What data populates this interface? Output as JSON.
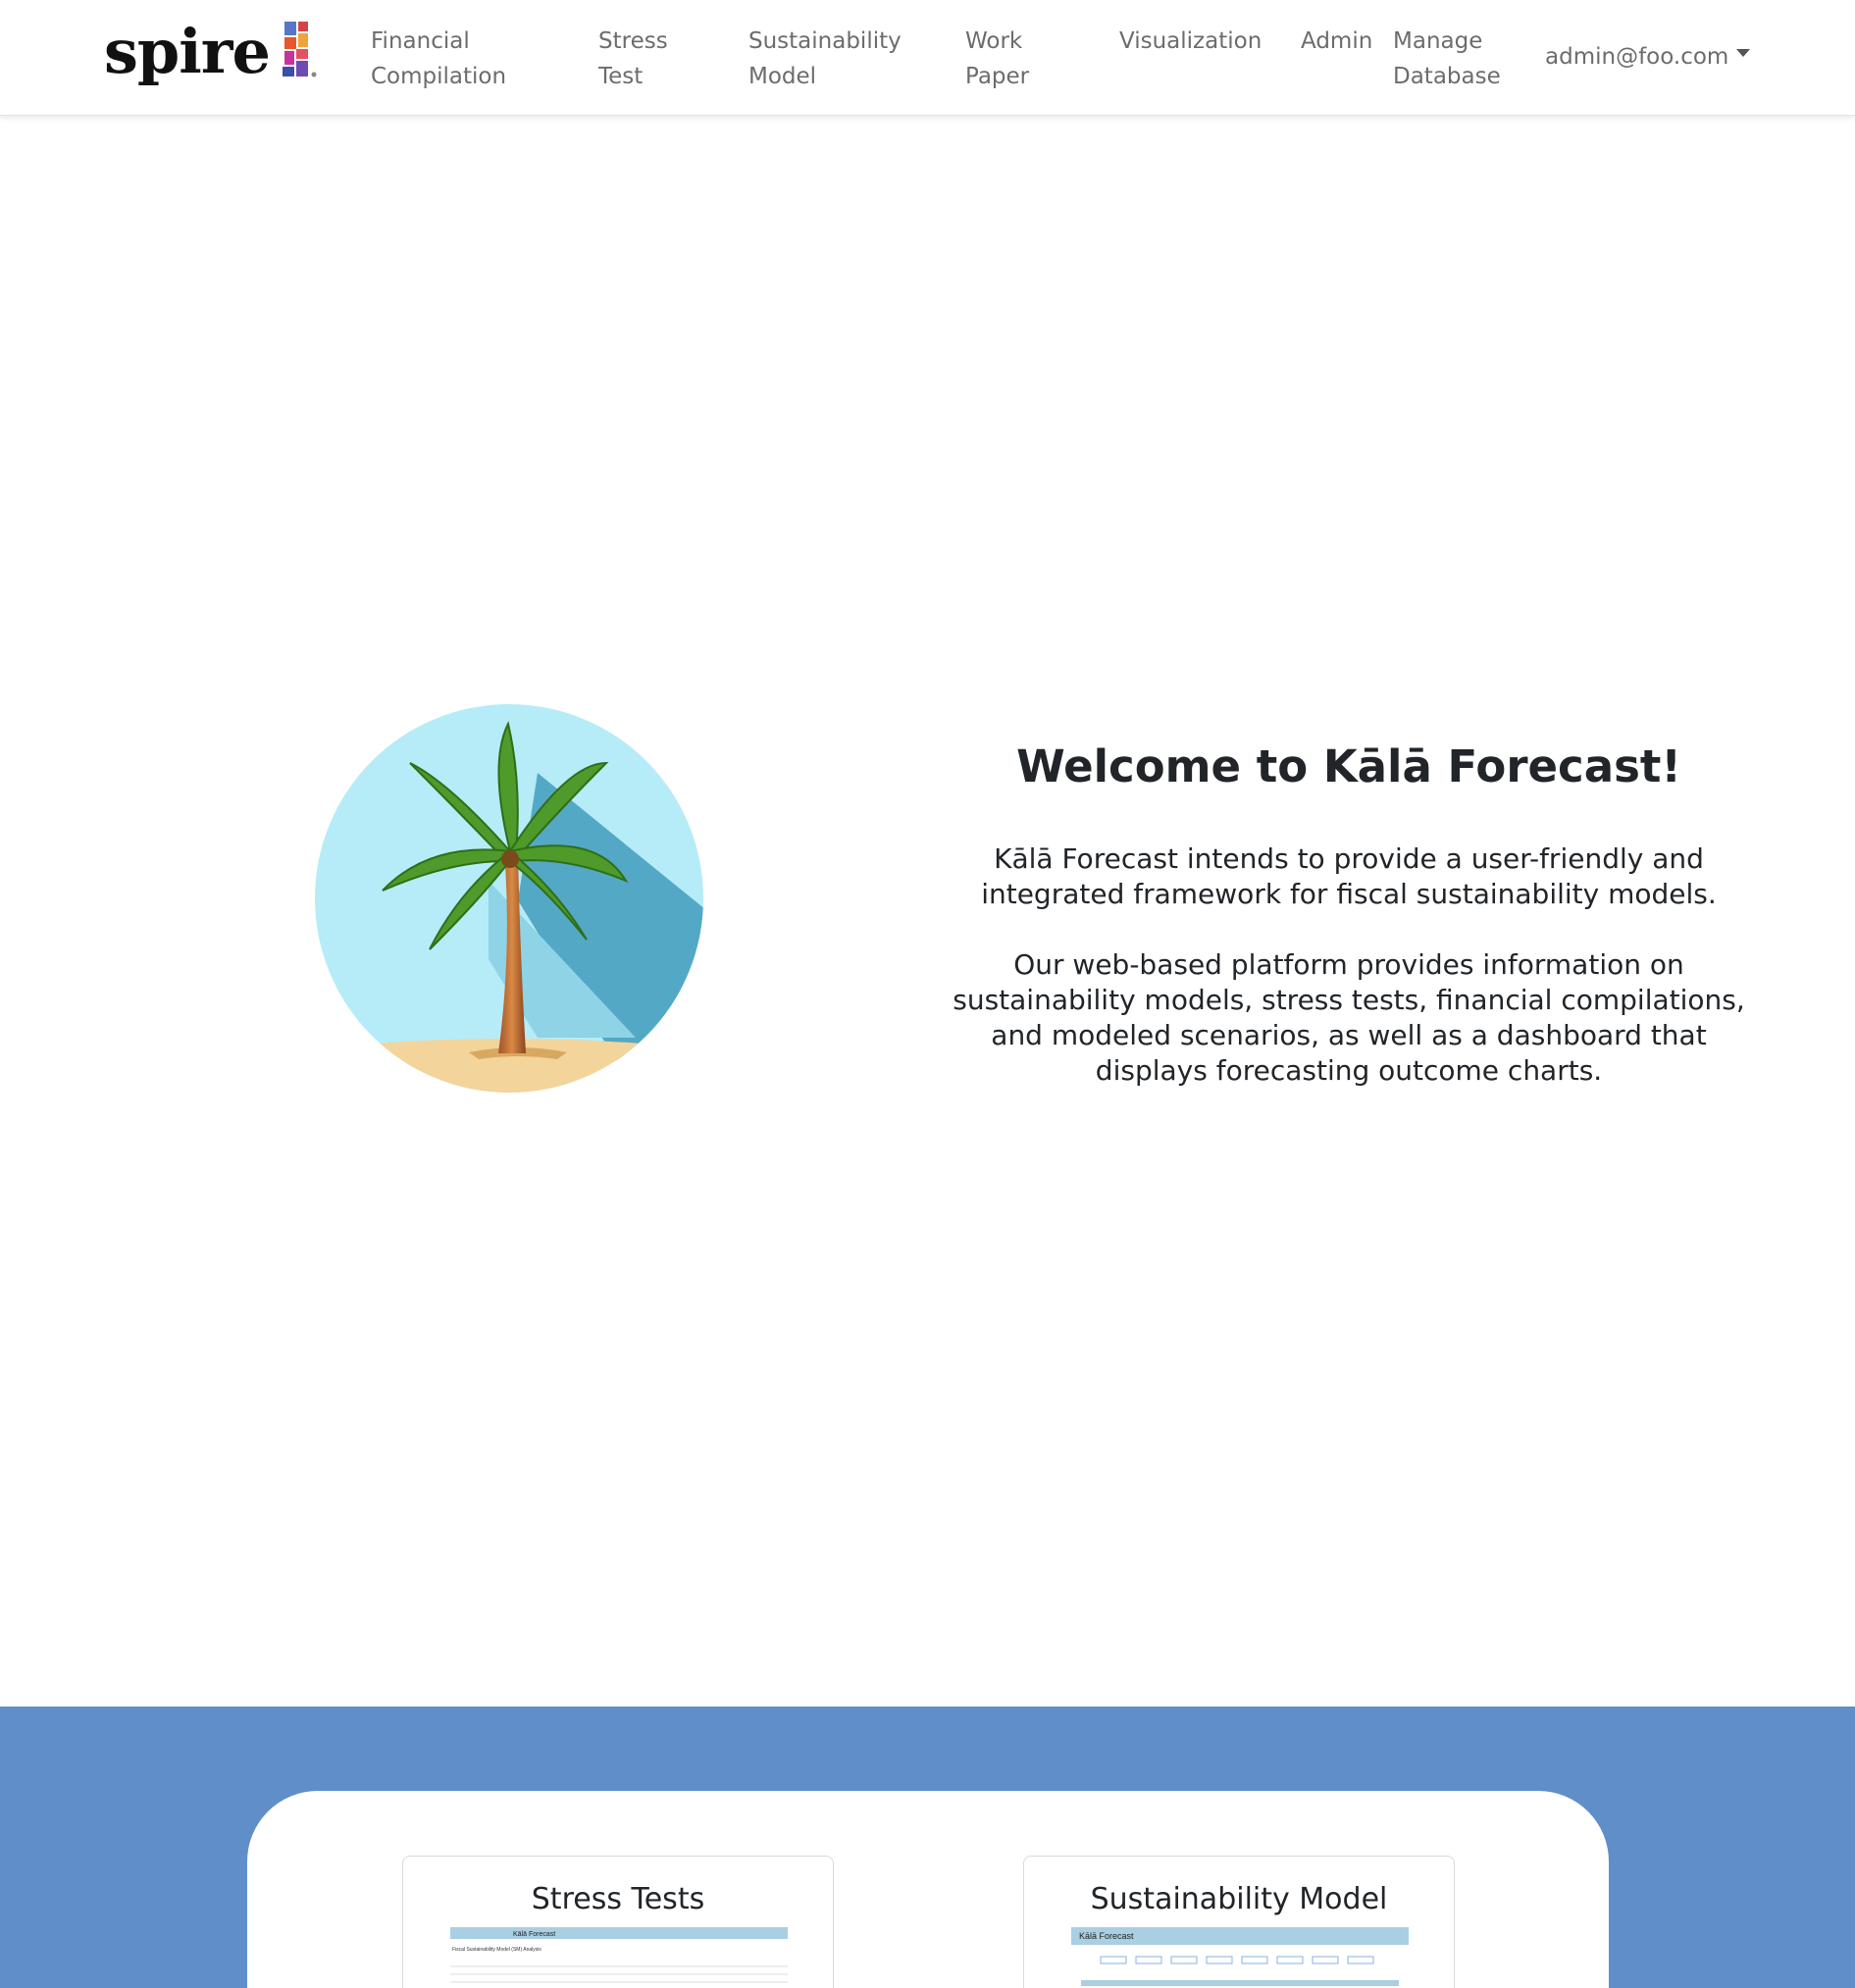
{
  "brand": {
    "name": "spire"
  },
  "nav": {
    "items": [
      {
        "line1": "Financial",
        "line2": "Compilation"
      },
      {
        "line1": "Stress",
        "line2": "Test"
      },
      {
        "line1": "Sustainability",
        "line2": "Model"
      },
      {
        "line1": "Work",
        "line2": "Paper"
      },
      {
        "line1": "Visualization",
        "line2": ""
      },
      {
        "line1": "Admin",
        "line2": ""
      },
      {
        "line1": "Manage",
        "line2": "Database"
      }
    ],
    "user": "admin@foo.com"
  },
  "hero": {
    "title": "Welcome to Kālā Forecast!",
    "paragraph1": "Kālā Forecast intends to provide a user-friendly and integrated framework for fiscal sustainability models.",
    "paragraph2": "Our web-based platform provides information on sustainability models, stress tests, financial compilations, and modeled scenarios, as well as a dashboard that displays forecasting outcome charts."
  },
  "features": {
    "cards": [
      {
        "title": "Stress Tests",
        "thumb_caption": "Kālā Forecast",
        "thumb_subtitle": "Fiscal Sustainability Model (SM) Analysis"
      },
      {
        "title": "Sustainability Model",
        "thumb_caption": "Kālā Forecast",
        "thumb_subtitle": ""
      }
    ]
  },
  "colors": {
    "band": "#608ec9",
    "nav_text": "#6c6c6c",
    "palm_sky": "#b6ecf7",
    "palm_shadow": "#53a9c5"
  }
}
